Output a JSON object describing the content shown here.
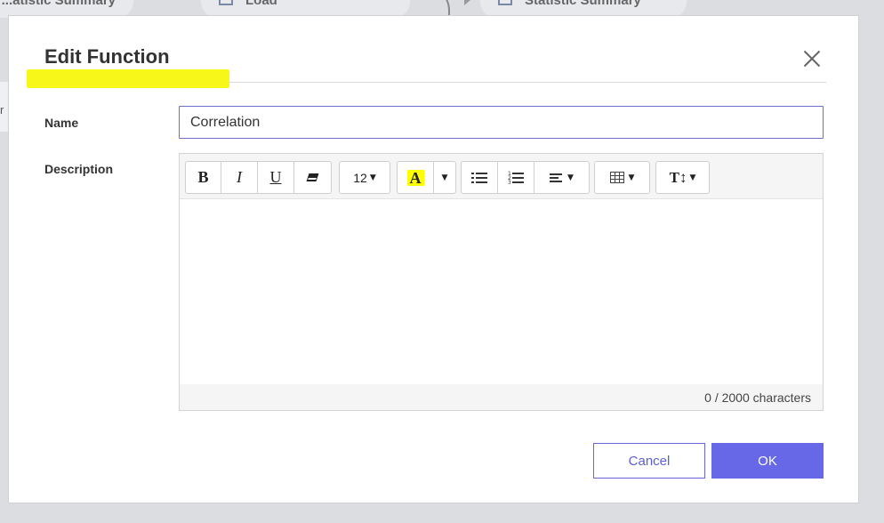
{
  "background": {
    "tabs": [
      {
        "label": "...atistic Summary"
      },
      {
        "label": "Load"
      },
      {
        "label": "Statistic Summary"
      }
    ],
    "side_label": "r"
  },
  "dialog": {
    "title": "Edit Function",
    "close_icon": "close-icon",
    "name_label": "Name",
    "name_value": "Correlation",
    "description_label": "Description",
    "toolbar": {
      "bold": "B",
      "italic": "I",
      "underline": "U",
      "font_size": "12",
      "highlight": "A",
      "style": "T↕"
    },
    "highlight_color": "#ffff00",
    "counter": "0 / 2000 characters",
    "cancel_label": "Cancel",
    "ok_label": "OK",
    "accent_color": "#6768e8",
    "title_highlight_color": "#f7f71a"
  }
}
